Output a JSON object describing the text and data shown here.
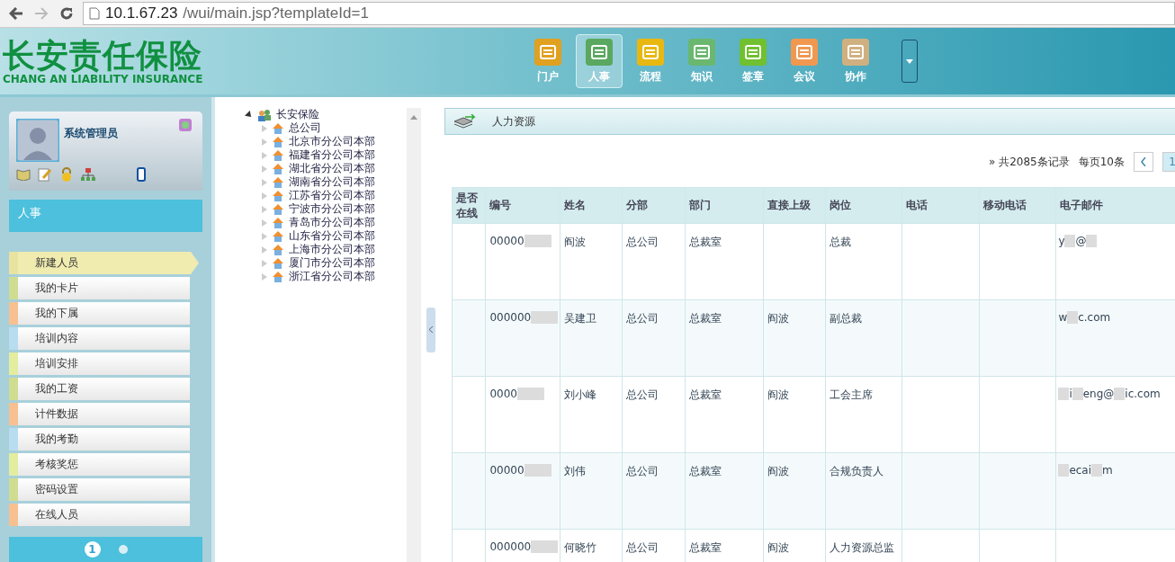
{
  "browser": {
    "url_host": "10.1.67.23",
    "url_path": "/wui/main.jsp?templateId=1"
  },
  "logo": {
    "title": "长安责任保险",
    "subtitle": "CHANG AN LIABILITY INSURANCE"
  },
  "nav": [
    {
      "label": "门户",
      "color": "#e0a020",
      "selected": false
    },
    {
      "label": "人事",
      "color": "#5aa860",
      "selected": true
    },
    {
      "label": "流程",
      "color": "#e8b810",
      "selected": false
    },
    {
      "label": "知识",
      "color": "#6ab870",
      "selected": false
    },
    {
      "label": "签章",
      "color": "#70c030",
      "selected": false
    },
    {
      "label": "会议",
      "color": "#f09850",
      "selected": false
    },
    {
      "label": "协作",
      "color": "#d0b080",
      "selected": false
    }
  ],
  "user": {
    "name": "系统管理员"
  },
  "section": {
    "title": "人事"
  },
  "menu": [
    {
      "label": "新建人员",
      "color": "#e8e4a0",
      "selected": true
    },
    {
      "label": "我的卡片",
      "color": "#d0dc90",
      "selected": false
    },
    {
      "label": "我的下属",
      "color": "#f8c090",
      "selected": false
    },
    {
      "label": "培训内容",
      "color": "#b8dcf0",
      "selected": false
    },
    {
      "label": "培训安排",
      "color": "#e4eca0",
      "selected": false
    },
    {
      "label": "我的工资",
      "color": "#d0dc90",
      "selected": false
    },
    {
      "label": "计件数据",
      "color": "#f8c090",
      "selected": false
    },
    {
      "label": "我的考勤",
      "color": "#b8dcf0",
      "selected": false
    },
    {
      "label": "考核奖惩",
      "color": "#e4eca0",
      "selected": false
    },
    {
      "label": "密码设置",
      "color": "#d0dc90",
      "selected": false
    },
    {
      "label": "在线人员",
      "color": "#f8c090",
      "selected": false
    }
  ],
  "pager_dots": [
    {
      "label": "1",
      "selected": true
    },
    {
      "selected": false
    }
  ],
  "tree": {
    "label": "长安保险",
    "expanded": true,
    "children": [
      {
        "label": "总公司",
        "expanded": false
      },
      {
        "label": "北京市分公司本部",
        "expanded": false
      },
      {
        "label": "福建省分公司本部",
        "expanded": false
      },
      {
        "label": "湖北省分公司本部",
        "expanded": false
      },
      {
        "label": "湖南省分公司本部",
        "expanded": false
      },
      {
        "label": "江苏省分公司本部",
        "expanded": false
      },
      {
        "label": "宁波市分公司本部",
        "expanded": false
      },
      {
        "label": "青岛市分公司本部",
        "expanded": false
      },
      {
        "label": "山东省分公司本部",
        "expanded": false
      },
      {
        "label": "上海市分公司本部",
        "expanded": false
      },
      {
        "label": "厦门市分公司本部",
        "expanded": false
      },
      {
        "label": "浙江省分公司本部",
        "expanded": false
      }
    ]
  },
  "panel": {
    "title": "人力资源"
  },
  "pagination": {
    "total": "» 共2085条记录",
    "per_page": "每页10条",
    "current": "1"
  },
  "table": {
    "columns": [
      "是否在线",
      "编号",
      "姓名",
      "分部",
      "部门",
      "直接上级",
      "岗位",
      "电话",
      "移动电话",
      "电子邮件"
    ],
    "rows": [
      {
        "id": [
          {
            "kind": "text",
            "text": "00000"
          },
          {
            "kind": "redacted"
          }
        ],
        "name": "阎波",
        "branch": "总公司",
        "dept": "总裁室",
        "post": "总裁",
        "email": [
          {
            "kind": "text",
            "text": "y"
          },
          {
            "kind": "redacted"
          },
          {
            "kind": "text",
            "text": "@"
          },
          {
            "kind": "redacted"
          }
        ]
      },
      {
        "id": [
          {
            "kind": "text",
            "text": "000000"
          },
          {
            "kind": "redacted"
          }
        ],
        "name": "吴建卫",
        "branch": "总公司",
        "dept": "总裁室",
        "manager": "阎波",
        "post": "副总裁",
        "email": [
          {
            "kind": "text",
            "text": "w"
          },
          {
            "kind": "redacted"
          },
          {
            "kind": "text",
            "text": "c.com"
          }
        ]
      },
      {
        "id": [
          {
            "kind": "text",
            "text": "0000"
          },
          {
            "kind": "redacted"
          }
        ],
        "name": "刘小峰",
        "branch": "总公司",
        "dept": "总裁室",
        "manager": "阎波",
        "post": "工会主席",
        "email": [
          {
            "kind": "redacted"
          },
          {
            "kind": "text",
            "text": "i"
          },
          {
            "kind": "redacted"
          },
          {
            "kind": "text",
            "text": "eng@"
          },
          {
            "kind": "redacted"
          },
          {
            "kind": "text",
            "text": "ic.com"
          }
        ]
      },
      {
        "id": [
          {
            "kind": "text",
            "text": "00000"
          },
          {
            "kind": "redacted"
          }
        ],
        "name": "刘伟",
        "branch": "总公司",
        "dept": "总裁室",
        "manager": "阎波",
        "post": "合规负责人",
        "email": [
          {
            "kind": "redacted"
          },
          {
            "kind": "text",
            "text": "ecai"
          },
          {
            "kind": "redacted"
          },
          {
            "kind": "text",
            "text": "m"
          }
        ]
      },
      {
        "id": [
          {
            "kind": "text",
            "text": "000000"
          },
          {
            "kind": "redacted"
          }
        ],
        "name": "何晓竹",
        "branch": "总公司",
        "dept": "总裁室",
        "manager": "阎波",
        "post": "人力资源总监"
      }
    ]
  }
}
